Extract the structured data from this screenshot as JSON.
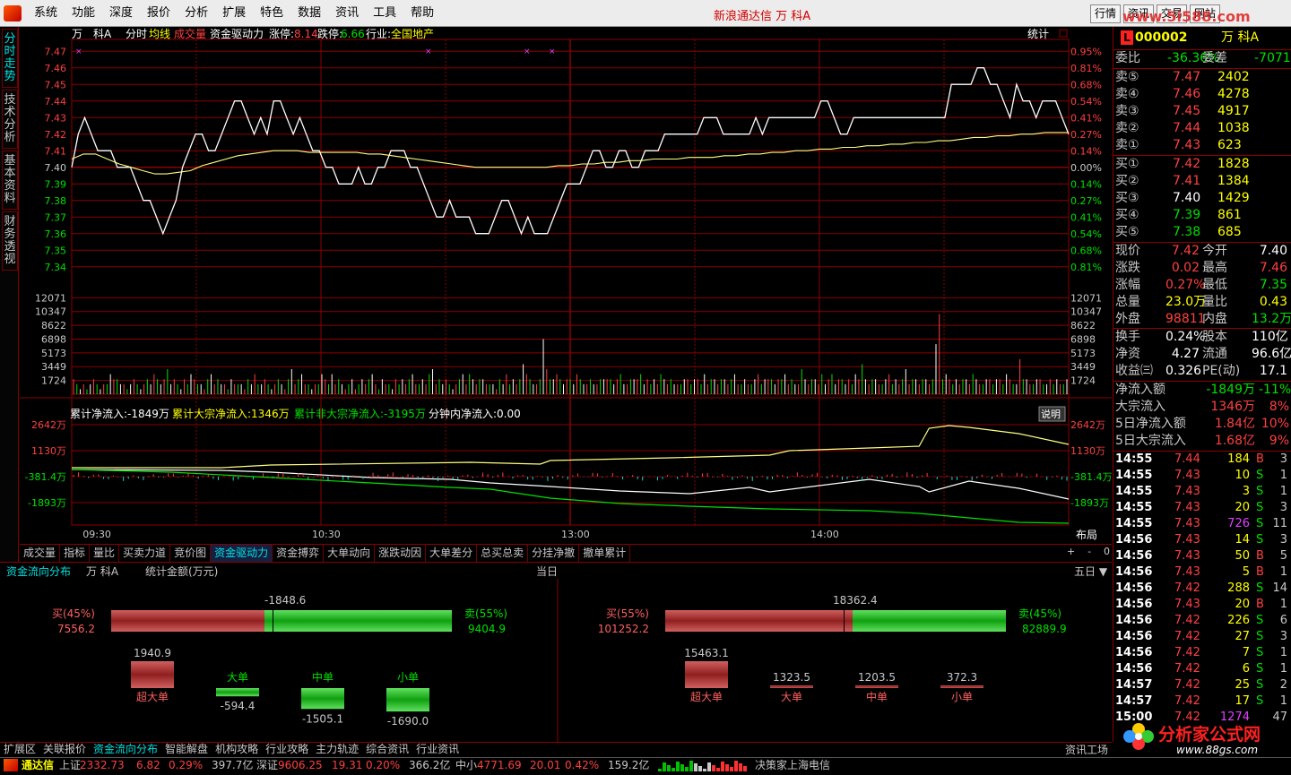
{
  "menubar": {
    "items": [
      "系统",
      "功能",
      "深度",
      "报价",
      "分析",
      "扩展",
      "特色",
      "数据",
      "资讯",
      "工具",
      "帮助"
    ],
    "title": "新浪通达信 万 科A",
    "right_tabs": [
      "行情",
      "资讯",
      "交易",
      "网站"
    ],
    "watermark": "www.5i588.com"
  },
  "sidetabs": [
    "分时走势",
    "技术分析",
    "基本资料",
    "财务透视"
  ],
  "chart": {
    "header_left": [
      "万",
      "科A",
      "分时",
      "均线",
      "成交量",
      "资金驱动力",
      "涨停:",
      "8.14",
      "跌停:",
      "6.66",
      "行业:",
      "全国地产"
    ],
    "header_right": "统计",
    "price_axis": [
      "7.47",
      "7.46",
      "7.45",
      "7.44",
      "7.43",
      "7.42",
      "7.41",
      "7.40",
      "7.39",
      "7.38",
      "7.37",
      "7.36",
      "7.35",
      "7.34"
    ],
    "pct_axis": [
      "0.95%",
      "0.81%",
      "0.68%",
      "0.54%",
      "0.41%",
      "0.27%",
      "0.14%",
      "0.00%",
      "0.14%",
      "0.27%",
      "0.41%",
      "0.54%",
      "0.68%",
      "0.81%"
    ],
    "vol_axis": [
      "12071",
      "10347",
      "8622",
      "6898",
      "5173",
      "3449",
      "1724"
    ],
    "flow_header": [
      "累计净流入:-1849万",
      "累计大宗净流入:1346万",
      "累计非大宗净流入:-3195万",
      "分钟内净流入:0.00"
    ],
    "flow_note": "说明",
    "flow_axis": [
      "2642万",
      "1130万",
      "-381.4万",
      "-1893万"
    ],
    "time_axis": [
      "09:30",
      "10:30",
      "13:00",
      "14:00"
    ],
    "layout_btn": "布局",
    "price_series": [
      7.4,
      7.42,
      7.43,
      7.42,
      7.41,
      7.41,
      7.41,
      7.4,
      7.4,
      7.4,
      7.39,
      7.38,
      7.38,
      7.37,
      7.36,
      7.37,
      7.38,
      7.4,
      7.41,
      7.42,
      7.42,
      7.41,
      7.41,
      7.42,
      7.43,
      7.44,
      7.44,
      7.43,
      7.42,
      7.43,
      7.42,
      7.44,
      7.44,
      7.43,
      7.42,
      7.43,
      7.42,
      7.41,
      7.41,
      7.4,
      7.4,
      7.39,
      7.39,
      7.39,
      7.4,
      7.39,
      7.39,
      7.4,
      7.4,
      7.41,
      7.41,
      7.41,
      7.4,
      7.4,
      7.39,
      7.38,
      7.37,
      7.37,
      7.38,
      7.37,
      7.37,
      7.37,
      7.36,
      7.36,
      7.36,
      7.37,
      7.38,
      7.38,
      7.37,
      7.36,
      7.37,
      7.36,
      7.36,
      7.36,
      7.37,
      7.38,
      7.39,
      7.39,
      7.39,
      7.4,
      7.41,
      7.41,
      7.4,
      7.4,
      7.41,
      7.41,
      7.4,
      7.4,
      7.41,
      7.41,
      7.41,
      7.42,
      7.42,
      7.42,
      7.42,
      7.42,
      7.42,
      7.43,
      7.43,
      7.43,
      7.42,
      7.42,
      7.42,
      7.42,
      7.42,
      7.43,
      7.42,
      7.43,
      7.43,
      7.43,
      7.43,
      7.43,
      7.43,
      7.43,
      7.43,
      7.44,
      7.44,
      7.43,
      7.42,
      7.42,
      7.43,
      7.43,
      7.43,
      7.43,
      7.43,
      7.43,
      7.43,
      7.43,
      7.43,
      7.43,
      7.43,
      7.43,
      7.43,
      7.43,
      7.43,
      7.45,
      7.45,
      7.45,
      7.45,
      7.46,
      7.46,
      7.45,
      7.45,
      7.44,
      7.43,
      7.45,
      7.44,
      7.44,
      7.43,
      7.44,
      7.44,
      7.44,
      7.43,
      7.42
    ],
    "avg_series": [
      7.405,
      7.408,
      7.408,
      7.405,
      7.402,
      7.4,
      7.398,
      7.396,
      7.396,
      7.397,
      7.398,
      7.401,
      7.403,
      7.405,
      7.407,
      7.408,
      7.409,
      7.41,
      7.41,
      7.41,
      7.409,
      7.409,
      7.409,
      7.409,
      7.409,
      7.408,
      7.408,
      7.407,
      7.406,
      7.405,
      7.404,
      7.403,
      7.402,
      7.401,
      7.4,
      7.4,
      7.4,
      7.4,
      7.4,
      7.4,
      7.4,
      7.401,
      7.401,
      7.402,
      7.402,
      7.403,
      7.403,
      7.404,
      7.404,
      7.405,
      7.405,
      7.405,
      7.406,
      7.406,
      7.406,
      7.407,
      7.407,
      7.408,
      7.408,
      7.409,
      7.409,
      7.41,
      7.41,
      7.411,
      7.411,
      7.412,
      7.412,
      7.413,
      7.413,
      7.414,
      7.414,
      7.415,
      7.415,
      7.416,
      7.416,
      7.417,
      7.418,
      7.418,
      7.419,
      7.419,
      7.42,
      7.42,
      7.421,
      7.421,
      7.421
    ],
    "volume_series": [
      3,
      2,
      1,
      2,
      1,
      2,
      3,
      2,
      1,
      2,
      2,
      4,
      3,
      3,
      2,
      2,
      1,
      2,
      3,
      2,
      1,
      2,
      3,
      2,
      4,
      3,
      2,
      3,
      5,
      2,
      3,
      2,
      1,
      3,
      2,
      4,
      3,
      2,
      2,
      1,
      3,
      4,
      2,
      3,
      2,
      2,
      1,
      3,
      2,
      2,
      2,
      1,
      3,
      2,
      4,
      2,
      2,
      3,
      2,
      1,
      2,
      3,
      2,
      1,
      3,
      5,
      2,
      3,
      4,
      2,
      2,
      1,
      2,
      2,
      4,
      3,
      2,
      4,
      2,
      3,
      2,
      1,
      2,
      3,
      1,
      2,
      3,
      2,
      3,
      4,
      2,
      1,
      3,
      2,
      2,
      1,
      3,
      2,
      3,
      2,
      3,
      4,
      2,
      2,
      3,
      2,
      4,
      5,
      2,
      3,
      2,
      3,
      2,
      1,
      2,
      3,
      4,
      2,
      4,
      3,
      2,
      3,
      3,
      2,
      2,
      2,
      1,
      3,
      2,
      4,
      2,
      3,
      2,
      3,
      6,
      4,
      3,
      2,
      2,
      3,
      11,
      5,
      3,
      3,
      4,
      3,
      2,
      3,
      3,
      2,
      4,
      3,
      2,
      2,
      3,
      2,
      2,
      3,
      3,
      3,
      3,
      2,
      3,
      4,
      2,
      2,
      3,
      3,
      3,
      4,
      2,
      3,
      2,
      3,
      2,
      4,
      3,
      2,
      3,
      2,
      2,
      2,
      3,
      3,
      2,
      3,
      3,
      2,
      4,
      2,
      3,
      3,
      2,
      3,
      3,
      2,
      3,
      4,
      2,
      2,
      3,
      2,
      2,
      3,
      4,
      2,
      3,
      3,
      3,
      2,
      3,
      3,
      4,
      2,
      3,
      2,
      2,
      5,
      3,
      2,
      3,
      3,
      2,
      4,
      2,
      3,
      4,
      2,
      3,
      3,
      2,
      3,
      2,
      4,
      3,
      6,
      3,
      2,
      3,
      3,
      2,
      2,
      3,
      4,
      2,
      3,
      2,
      3,
      5,
      2,
      3,
      3,
      2,
      3,
      3,
      2,
      3,
      10,
      16,
      3,
      4,
      3,
      2,
      3,
      2,
      3,
      3,
      2,
      4,
      3,
      2,
      2,
      3,
      3,
      2,
      3,
      3,
      2,
      4,
      3,
      2,
      2,
      7,
      3,
      3,
      2,
      2,
      3,
      3,
      2,
      2,
      3,
      2,
      3,
      2,
      2,
      3
    ]
  },
  "midtabs": [
    "成交量",
    "指标",
    "量比",
    "买卖力道",
    "竞价图",
    "资金驱动力",
    "资金搏弈",
    "大单动向",
    "涨跌动因",
    "大单差分",
    "总买总卖",
    "分挂净撤",
    "撤单累计"
  ],
  "midtabs_ctl": [
    "布局",
    "+",
    "-",
    "0"
  ],
  "flow": {
    "title": "资金流向分布",
    "stock": "万 科A",
    "unit": "统计金额(万元)",
    "day": "当日",
    "five_day": "五日 ▼",
    "left": {
      "net": "-1848.6",
      "buy_label": "买(45%)",
      "buy_value": "7556.2",
      "sell_label": "卖(55%)",
      "sell_value": "9404.9",
      "buy_frac": 0.45,
      "cats": [
        {
          "name": "超大单",
          "value": "1940.9"
        },
        {
          "name": "大单",
          "value": "-594.4"
        },
        {
          "name": "中单",
          "value": "-1505.1"
        },
        {
          "name": "小单",
          "value": "-1690.0"
        }
      ]
    },
    "right": {
      "net": "18362.4",
      "buy_label": "买(55%)",
      "buy_value": "101252.2",
      "sell_label": "卖(45%)",
      "sell_value": "82889.9",
      "buy_frac": 0.55,
      "cats": [
        {
          "name": "超大单",
          "value": "15463.1"
        },
        {
          "name": "大单",
          "value": "1323.5"
        },
        {
          "name": "中单",
          "value": "1203.5"
        },
        {
          "name": "小单",
          "value": "372.3"
        }
      ]
    }
  },
  "quote": {
    "code": "000002",
    "name": "万 科A",
    "badge": "L",
    "weibi": {
      "label": "委比",
      "value": "-36.36%",
      "label2": "委差",
      "value2": "-7071"
    },
    "sells": [
      {
        "l": "卖⑤",
        "p": "7.47",
        "v": "2402"
      },
      {
        "l": "卖④",
        "p": "7.46",
        "v": "4278"
      },
      {
        "l": "卖③",
        "p": "7.45",
        "v": "4917"
      },
      {
        "l": "卖②",
        "p": "7.44",
        "v": "1038"
      },
      {
        "l": "卖①",
        "p": "7.43",
        "v": "623"
      }
    ],
    "buys": [
      {
        "l": "买①",
        "p": "7.42",
        "v": "1828"
      },
      {
        "l": "买②",
        "p": "7.41",
        "v": "1384"
      },
      {
        "l": "买③",
        "p": "7.40",
        "v": "1429"
      },
      {
        "l": "买④",
        "p": "7.39",
        "v": "861"
      },
      {
        "l": "买⑤",
        "p": "7.38",
        "v": "685"
      }
    ],
    "stats": [
      [
        "现价",
        "7.42",
        "今开",
        "7.40"
      ],
      [
        "涨跌",
        "0.02",
        "最高",
        "7.46"
      ],
      [
        "涨幅",
        "0.27%",
        "最低",
        "7.35"
      ],
      [
        "总量",
        "23.0万",
        "量比",
        "0.43"
      ],
      [
        "外盘",
        "98811",
        "内盘",
        "13.2万"
      ],
      [
        "换手",
        "0.24%",
        "股本",
        "110亿"
      ],
      [
        "净资",
        "4.27",
        "流通",
        "96.6亿"
      ],
      [
        "收益㈢",
        "0.326",
        "PE(动)",
        "17.1"
      ]
    ],
    "flows": [
      [
        "净流入额",
        "-1849万",
        "-11%"
      ],
      [
        "大宗流入",
        "1346万",
        "8%"
      ],
      [
        "5日净流入额",
        "1.84亿",
        "10%"
      ],
      [
        "5日大宗流入",
        "1.68亿",
        "9%"
      ]
    ],
    "ticks": [
      [
        "14:55",
        "7.44",
        "184",
        "B",
        "3"
      ],
      [
        "14:55",
        "7.43",
        "10",
        "S",
        "1"
      ],
      [
        "14:55",
        "7.43",
        "3",
        "S",
        "1"
      ],
      [
        "14:55",
        "7.43",
        "20",
        "S",
        "3"
      ],
      [
        "14:55",
        "7.43",
        "726",
        "S",
        "11"
      ],
      [
        "14:56",
        "7.43",
        "14",
        "S",
        "3"
      ],
      [
        "14:56",
        "7.43",
        "50",
        "B",
        "5"
      ],
      [
        "14:56",
        "7.43",
        "5",
        "B",
        "1"
      ],
      [
        "14:56",
        "7.42",
        "288",
        "S",
        "14"
      ],
      [
        "14:56",
        "7.43",
        "20",
        "B",
        "1"
      ],
      [
        "14:56",
        "7.42",
        "226",
        "S",
        "6"
      ],
      [
        "14:56",
        "7.42",
        "27",
        "S",
        "3"
      ],
      [
        "14:56",
        "7.42",
        "7",
        "S",
        "1"
      ],
      [
        "14:56",
        "7.42",
        "6",
        "S",
        "1"
      ],
      [
        "14:57",
        "7.42",
        "25",
        "S",
        "2"
      ],
      [
        "14:57",
        "7.42",
        "17",
        "S",
        "1"
      ],
      [
        "15:00",
        "7.42",
        "1274",
        "",
        "47"
      ]
    ]
  },
  "bottom_tabs": [
    "扩展区",
    "关联报价",
    "资金流向分布",
    "智能解盘",
    "机构攻略",
    "行业攻略",
    "主力轨迹",
    "综合资讯",
    "行业资讯"
  ],
  "bottom_right": "资讯工场",
  "status": {
    "brand": "通达信",
    "sh_label": "上证",
    "sh_val": "2332.73",
    "sh_chg": "6.82",
    "sh_pct": "0.29%",
    "sh_amt": "397.7亿",
    "sz_label": "深证",
    "sz_val": "9606.25",
    "sz_chg": "19.31",
    "sz_pct": "0.20%",
    "sz_amt": "366.2亿",
    "zx_label": "中小",
    "zx_val": "4771.69",
    "zx_chg": "20.01",
    "zx_pct": "0.42%",
    "zx_amt": "159.2亿",
    "server": "决策家上海电信"
  },
  "corner_logo": {
    "text": "分析家公式网",
    "url": "www.88gs.com"
  },
  "colors": {
    "up": "#ff4040",
    "down": "#00e000",
    "grid": "#8c0000",
    "price_line": "#ffffff",
    "avg_line": "#ffff80",
    "accent": "#00e0e0"
  }
}
